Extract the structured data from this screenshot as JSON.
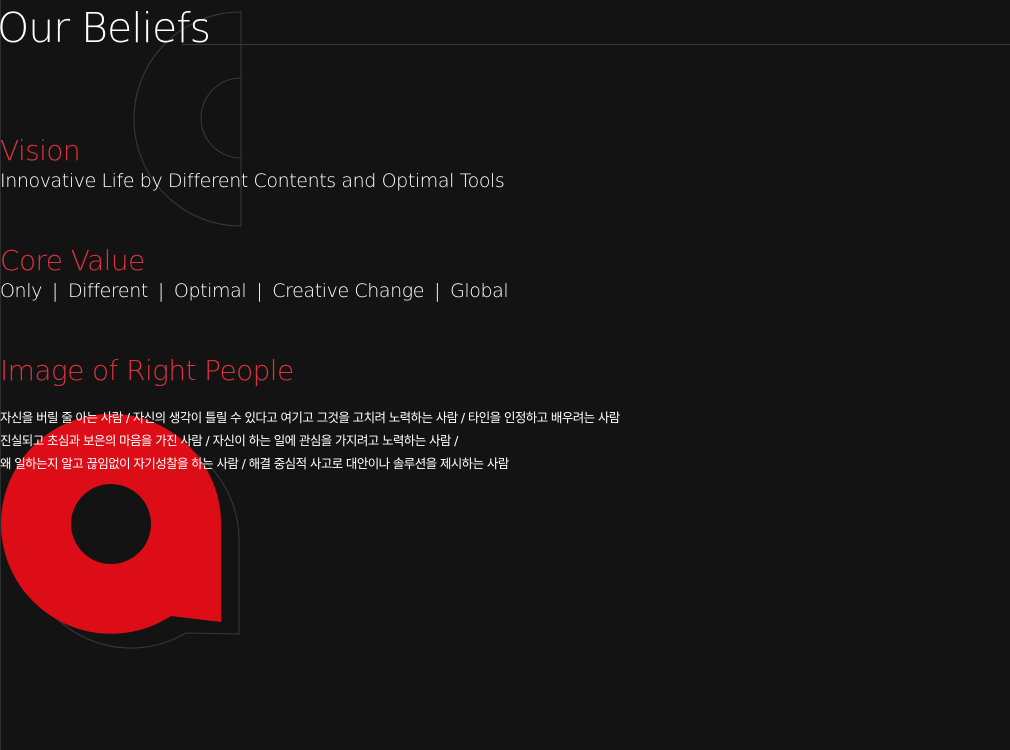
{
  "header": {
    "title": "Our Beliefs"
  },
  "colors": {
    "accent": "#e0313c",
    "logo_red": "#dc0d16",
    "background": "#131313"
  },
  "vision": {
    "heading": "Vision",
    "text": "Innovative Life by Different Contents and Optimal Tools"
  },
  "core_value": {
    "heading": "Core Value",
    "values": [
      "Only",
      "Different",
      "Optimal",
      "Creative Change",
      "Global"
    ],
    "separator": "|"
  },
  "right_people": {
    "heading": "Image of Right People",
    "lines": [
      "자신을 버릴 줄 아는 사람  /  자신의 생각이 틀릴 수 있다고 여기고 그것을 고치려 노력하는 사람  /   타인을 인정하고 배우려는 사람",
      "진실되고 초심과 보은의 마음을 가진 사람  /  자신이 하는 일에 관심을 가지려고 노력하는 사람  /",
      "왜 일하는지 알고 끊임없이 자기성찰을 하는 사람  /  해결 중심적 사고로 대안이나 솔루션을 제시하는 사람"
    ]
  },
  "icons": {
    "decor": "outline-c-mark-icon",
    "logo": "red-a-mark-icon"
  }
}
